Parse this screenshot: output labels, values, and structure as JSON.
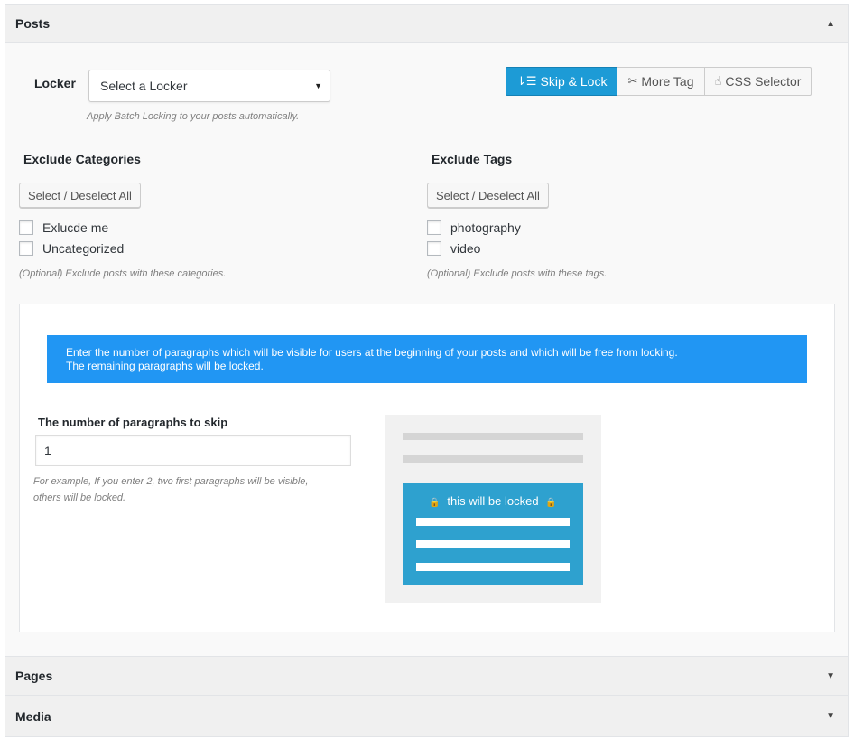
{
  "sections": {
    "posts": {
      "title": "Posts",
      "toggle": "▲"
    },
    "pages": {
      "title": "Pages",
      "toggle": "▼"
    },
    "media": {
      "title": "Media",
      "toggle": "▼"
    }
  },
  "locker": {
    "label": "Locker",
    "selected": "Select a Locker",
    "caret": "▼",
    "hint": "Apply Batch Locking to your posts automatically."
  },
  "modes": [
    {
      "label": "Skip & Lock",
      "icon": "sort-icon",
      "glyph": "⇂☰",
      "active": true
    },
    {
      "label": "More Tag",
      "icon": "scissors-icon",
      "glyph": "✂",
      "active": false
    },
    {
      "label": "CSS Selector",
      "icon": "pointer-hand-icon",
      "glyph": "☝",
      "active": false
    }
  ],
  "exclude_categories": {
    "title": "Exclude Categories",
    "button": "Select / Deselect All",
    "items": [
      "Exlucde me",
      "Uncategorized"
    ],
    "hint": "(Optional) Exclude posts with these categories."
  },
  "exclude_tags": {
    "title": "Exclude Tags",
    "button": "Select / Deselect All",
    "items": [
      "photography",
      "video"
    ],
    "hint": "(Optional) Exclude posts with these tags."
  },
  "info": {
    "line1": "Enter the number of paragraphs which will be visible for users at the beginning of your posts and which will be free from locking.",
    "line2": "The remaining paragraphs will be locked."
  },
  "skip": {
    "label": "The number of paragraphs to skip",
    "value": "1",
    "hint_line1": "For example, If you enter 2, two first paragraphs will be visible,",
    "hint_line2": "others will be locked."
  },
  "preview": {
    "locked_label": "this will be locked",
    "lock_glyph": "🔒"
  },
  "colors": {
    "accent": "#1d9bd6",
    "info_bar": "#2196f3",
    "locked_block": "#2ea1cf"
  }
}
